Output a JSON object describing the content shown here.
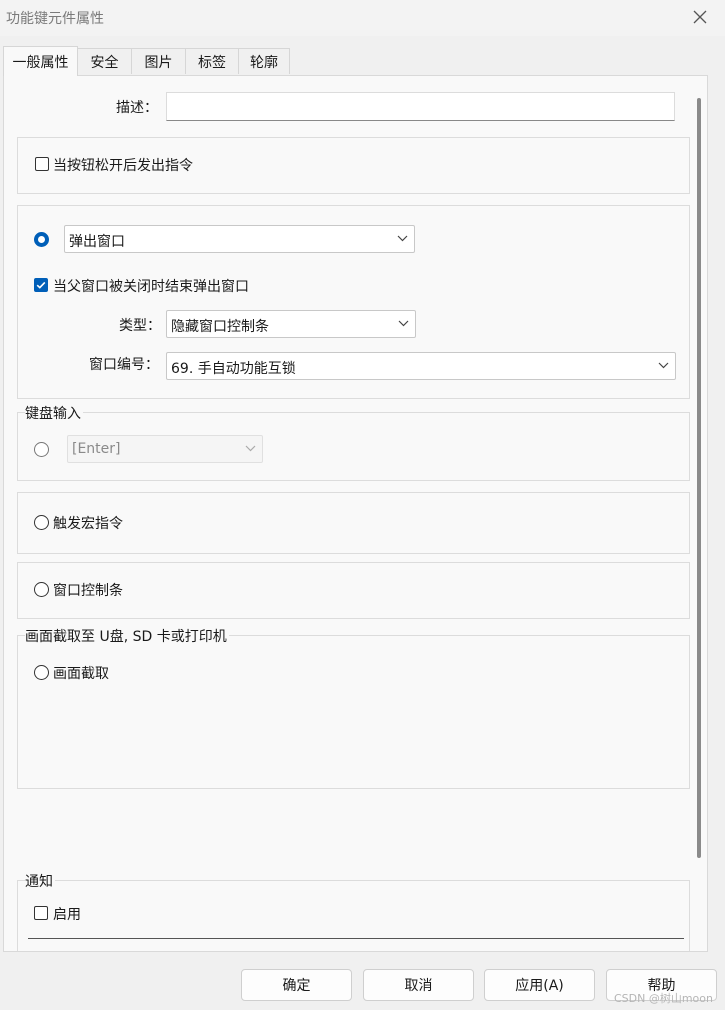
{
  "window": {
    "title": "功能键元件属性"
  },
  "tabs": [
    "一般属性",
    "安全",
    "图片",
    "标签",
    "轮廓"
  ],
  "general": {
    "description_label": "描述：",
    "description_value": "",
    "release_checkbox": {
      "label": "当按钮松开后发出指令",
      "checked": false
    },
    "popup": {
      "radio_selected": true,
      "mode_value": "弹出窗口",
      "close_with_parent": {
        "label": "当父窗口被关闭时结束弹出窗口",
        "checked": true
      },
      "type_label": "类型：",
      "type_value": "隐藏窗口控制条",
      "window_no_label": "窗口编号：",
      "window_no_value": "69. 手自动功能互锁"
    },
    "keyboard": {
      "group_label": "键盘输入",
      "value": "[Enter]",
      "selected": false
    },
    "macro": {
      "label": "触发宏指令",
      "selected": false
    },
    "window_bar": {
      "label": "窗口控制条",
      "selected": false
    },
    "capture": {
      "group_label": "画面截取至 U盘, SD 卡或打印机",
      "label": "画面截取",
      "selected": false
    },
    "notify": {
      "group_label": "通知",
      "enable_label": "启用",
      "checked": false
    }
  },
  "buttons": {
    "ok": "确定",
    "cancel": "取消",
    "apply": "应用(A)",
    "help": "帮助"
  },
  "watermark": "CSDN @树山moon",
  "colors": {
    "accent": "#005fb8",
    "background": "#f0f0f0"
  }
}
